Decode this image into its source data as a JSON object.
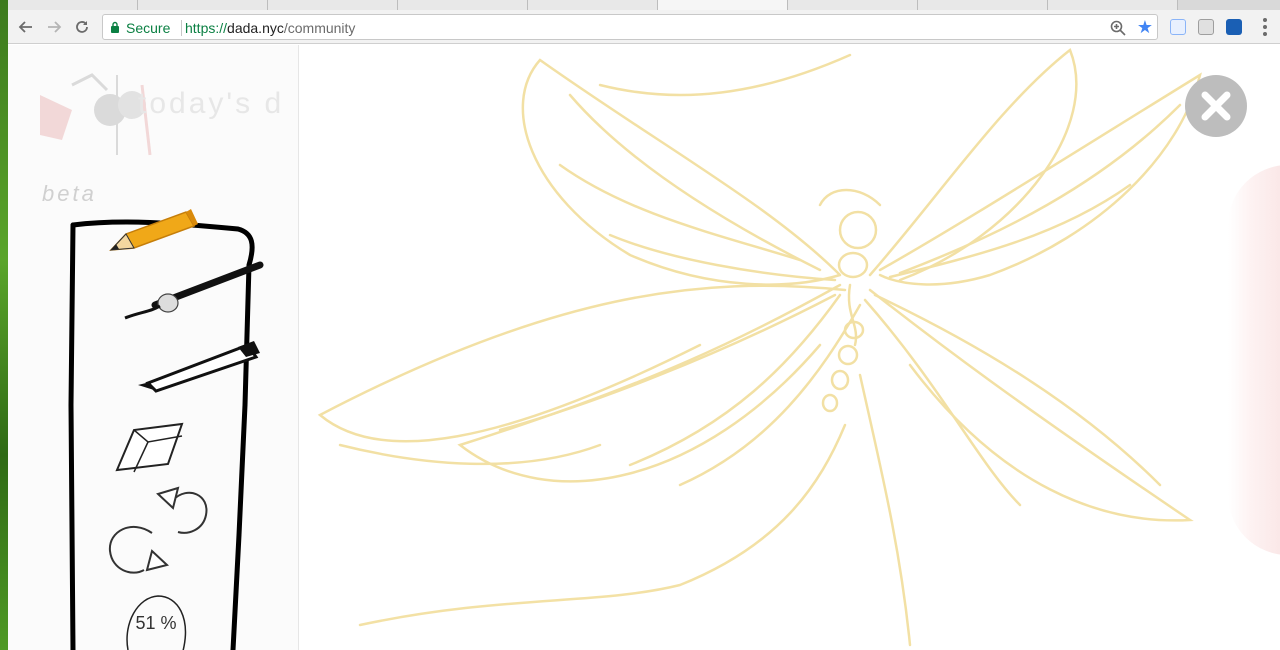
{
  "browser": {
    "secure_label": "Secure",
    "url_scheme": "https://",
    "url_host": "dada.nyc",
    "url_path": "/community"
  },
  "page": {
    "banner_title": "today's d",
    "beta_label": "beta",
    "zoom_percent_label": "51 %"
  },
  "colors": {
    "sketch": "#f2dfa0",
    "pencil": "#f0a818",
    "close_button": "#bdbdbd",
    "secure_green": "#0b8043",
    "star_blue": "#4285f4"
  },
  "icons": {
    "back": "arrow-left",
    "forward": "arrow-right",
    "reload": "circular-arrow",
    "lock": "padlock",
    "zoom": "magnifier",
    "bookmark": "star",
    "close": "x",
    "tools": [
      "pencil",
      "brush",
      "pen",
      "eraser",
      "redo",
      "undo"
    ]
  }
}
